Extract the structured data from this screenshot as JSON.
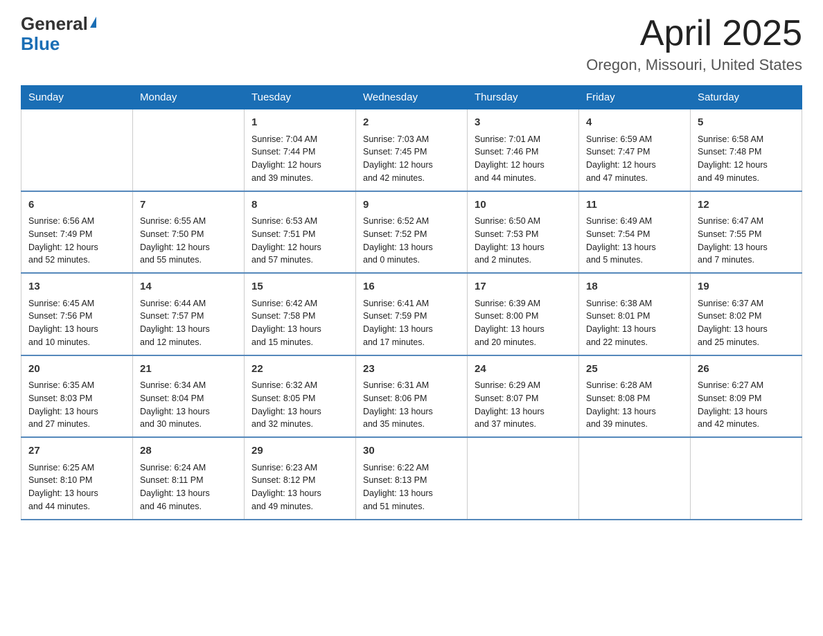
{
  "header": {
    "logo_general": "General",
    "logo_blue": "Blue",
    "month_title": "April 2025",
    "location": "Oregon, Missouri, United States"
  },
  "calendar": {
    "days_of_week": [
      "Sunday",
      "Monday",
      "Tuesday",
      "Wednesday",
      "Thursday",
      "Friday",
      "Saturday"
    ],
    "weeks": [
      [
        {
          "day": "",
          "info": ""
        },
        {
          "day": "",
          "info": ""
        },
        {
          "day": "1",
          "info": "Sunrise: 7:04 AM\nSunset: 7:44 PM\nDaylight: 12 hours\nand 39 minutes."
        },
        {
          "day": "2",
          "info": "Sunrise: 7:03 AM\nSunset: 7:45 PM\nDaylight: 12 hours\nand 42 minutes."
        },
        {
          "day": "3",
          "info": "Sunrise: 7:01 AM\nSunset: 7:46 PM\nDaylight: 12 hours\nand 44 minutes."
        },
        {
          "day": "4",
          "info": "Sunrise: 6:59 AM\nSunset: 7:47 PM\nDaylight: 12 hours\nand 47 minutes."
        },
        {
          "day": "5",
          "info": "Sunrise: 6:58 AM\nSunset: 7:48 PM\nDaylight: 12 hours\nand 49 minutes."
        }
      ],
      [
        {
          "day": "6",
          "info": "Sunrise: 6:56 AM\nSunset: 7:49 PM\nDaylight: 12 hours\nand 52 minutes."
        },
        {
          "day": "7",
          "info": "Sunrise: 6:55 AM\nSunset: 7:50 PM\nDaylight: 12 hours\nand 55 minutes."
        },
        {
          "day": "8",
          "info": "Sunrise: 6:53 AM\nSunset: 7:51 PM\nDaylight: 12 hours\nand 57 minutes."
        },
        {
          "day": "9",
          "info": "Sunrise: 6:52 AM\nSunset: 7:52 PM\nDaylight: 13 hours\nand 0 minutes."
        },
        {
          "day": "10",
          "info": "Sunrise: 6:50 AM\nSunset: 7:53 PM\nDaylight: 13 hours\nand 2 minutes."
        },
        {
          "day": "11",
          "info": "Sunrise: 6:49 AM\nSunset: 7:54 PM\nDaylight: 13 hours\nand 5 minutes."
        },
        {
          "day": "12",
          "info": "Sunrise: 6:47 AM\nSunset: 7:55 PM\nDaylight: 13 hours\nand 7 minutes."
        }
      ],
      [
        {
          "day": "13",
          "info": "Sunrise: 6:45 AM\nSunset: 7:56 PM\nDaylight: 13 hours\nand 10 minutes."
        },
        {
          "day": "14",
          "info": "Sunrise: 6:44 AM\nSunset: 7:57 PM\nDaylight: 13 hours\nand 12 minutes."
        },
        {
          "day": "15",
          "info": "Sunrise: 6:42 AM\nSunset: 7:58 PM\nDaylight: 13 hours\nand 15 minutes."
        },
        {
          "day": "16",
          "info": "Sunrise: 6:41 AM\nSunset: 7:59 PM\nDaylight: 13 hours\nand 17 minutes."
        },
        {
          "day": "17",
          "info": "Sunrise: 6:39 AM\nSunset: 8:00 PM\nDaylight: 13 hours\nand 20 minutes."
        },
        {
          "day": "18",
          "info": "Sunrise: 6:38 AM\nSunset: 8:01 PM\nDaylight: 13 hours\nand 22 minutes."
        },
        {
          "day": "19",
          "info": "Sunrise: 6:37 AM\nSunset: 8:02 PM\nDaylight: 13 hours\nand 25 minutes."
        }
      ],
      [
        {
          "day": "20",
          "info": "Sunrise: 6:35 AM\nSunset: 8:03 PM\nDaylight: 13 hours\nand 27 minutes."
        },
        {
          "day": "21",
          "info": "Sunrise: 6:34 AM\nSunset: 8:04 PM\nDaylight: 13 hours\nand 30 minutes."
        },
        {
          "day": "22",
          "info": "Sunrise: 6:32 AM\nSunset: 8:05 PM\nDaylight: 13 hours\nand 32 minutes."
        },
        {
          "day": "23",
          "info": "Sunrise: 6:31 AM\nSunset: 8:06 PM\nDaylight: 13 hours\nand 35 minutes."
        },
        {
          "day": "24",
          "info": "Sunrise: 6:29 AM\nSunset: 8:07 PM\nDaylight: 13 hours\nand 37 minutes."
        },
        {
          "day": "25",
          "info": "Sunrise: 6:28 AM\nSunset: 8:08 PM\nDaylight: 13 hours\nand 39 minutes."
        },
        {
          "day": "26",
          "info": "Sunrise: 6:27 AM\nSunset: 8:09 PM\nDaylight: 13 hours\nand 42 minutes."
        }
      ],
      [
        {
          "day": "27",
          "info": "Sunrise: 6:25 AM\nSunset: 8:10 PM\nDaylight: 13 hours\nand 44 minutes."
        },
        {
          "day": "28",
          "info": "Sunrise: 6:24 AM\nSunset: 8:11 PM\nDaylight: 13 hours\nand 46 minutes."
        },
        {
          "day": "29",
          "info": "Sunrise: 6:23 AM\nSunset: 8:12 PM\nDaylight: 13 hours\nand 49 minutes."
        },
        {
          "day": "30",
          "info": "Sunrise: 6:22 AM\nSunset: 8:13 PM\nDaylight: 13 hours\nand 51 minutes."
        },
        {
          "day": "",
          "info": ""
        },
        {
          "day": "",
          "info": ""
        },
        {
          "day": "",
          "info": ""
        }
      ]
    ]
  }
}
